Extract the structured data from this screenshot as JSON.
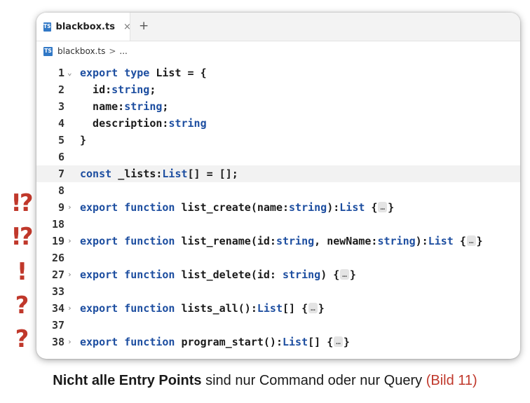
{
  "tab": {
    "icon": "TS",
    "label": "blackbox.ts",
    "close": "×",
    "add": "+"
  },
  "breadcrumb": {
    "file": "blackbox.ts",
    "sep": ">",
    "more": "..."
  },
  "marks": [
    "!?",
    "!?",
    "!",
    "?",
    "?"
  ],
  "lines": [
    {
      "n": "1",
      "fold": "v",
      "parts": [
        [
          "kw",
          "export type "
        ],
        [
          "op",
          "List = {"
        ]
      ]
    },
    {
      "n": "2",
      "parts": [
        [
          "op",
          "  id:"
        ],
        [
          "ty",
          "string"
        ],
        [
          "op",
          ";"
        ]
      ]
    },
    {
      "n": "3",
      "parts": [
        [
          "op",
          "  name:"
        ],
        [
          "ty",
          "string"
        ],
        [
          "op",
          ";"
        ]
      ]
    },
    {
      "n": "4",
      "parts": [
        [
          "op",
          "  description:"
        ],
        [
          "ty",
          "string"
        ]
      ]
    },
    {
      "n": "5",
      "parts": [
        [
          "op",
          "}"
        ]
      ]
    },
    {
      "n": "6",
      "parts": []
    },
    {
      "n": "7",
      "current": true,
      "parts": [
        [
          "kw",
          "const "
        ],
        [
          "op",
          "_lists:"
        ],
        [
          "ty",
          "List"
        ],
        [
          "op",
          "[] = [];"
        ]
      ]
    },
    {
      "n": "8",
      "parts": []
    },
    {
      "n": "9",
      "fold": ">",
      "parts": [
        [
          "kw",
          "export function "
        ],
        [
          "op",
          "list_create(name:"
        ],
        [
          "ty",
          "string"
        ],
        [
          "op",
          "):"
        ],
        [
          "ty",
          "List"
        ],
        [
          "op",
          " {"
        ],
        [
          "el",
          "…"
        ],
        [
          "op",
          "}"
        ]
      ]
    },
    {
      "n": "18",
      "parts": []
    },
    {
      "n": "19",
      "fold": ">",
      "parts": [
        [
          "kw",
          "export function "
        ],
        [
          "op",
          "list_rename(id:"
        ],
        [
          "ty",
          "string"
        ],
        [
          "op",
          ", newName:"
        ],
        [
          "ty",
          "string"
        ],
        [
          "op",
          "):"
        ],
        [
          "ty",
          "List"
        ],
        [
          "op",
          " {"
        ],
        [
          "el",
          "…"
        ],
        [
          "op",
          "}"
        ]
      ]
    },
    {
      "n": "26",
      "parts": []
    },
    {
      "n": "27",
      "fold": ">",
      "parts": [
        [
          "kw",
          "export function "
        ],
        [
          "op",
          "list_delete(id: "
        ],
        [
          "ty",
          "string"
        ],
        [
          "op",
          ") {"
        ],
        [
          "el",
          "…"
        ],
        [
          "op",
          "}"
        ]
      ]
    },
    {
      "n": "33",
      "parts": []
    },
    {
      "n": "34",
      "fold": ">",
      "parts": [
        [
          "kw",
          "export function "
        ],
        [
          "op",
          "lists_all():"
        ],
        [
          "ty",
          "List"
        ],
        [
          "op",
          "[] {"
        ],
        [
          "el",
          "…"
        ],
        [
          "op",
          "}"
        ]
      ]
    },
    {
      "n": "37",
      "parts": []
    },
    {
      "n": "38",
      "fold": ">",
      "parts": [
        [
          "kw",
          "export function "
        ],
        [
          "op",
          "program_start():"
        ],
        [
          "ty",
          "List"
        ],
        [
          "op",
          "[] {"
        ],
        [
          "el",
          "…"
        ],
        [
          "op",
          "}"
        ]
      ]
    }
  ],
  "caption": {
    "bold": "Nicht alle Entry Points",
    "rest": " sind nur Command oder nur Query ",
    "ref": "(Bild 11)"
  }
}
